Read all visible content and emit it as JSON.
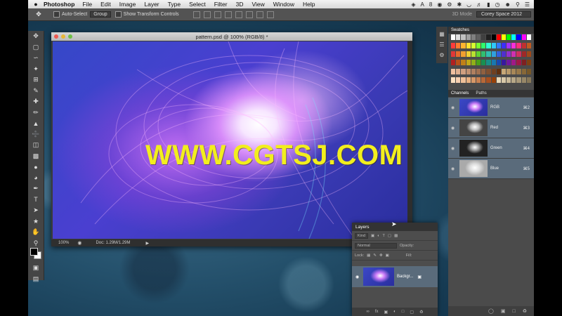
{
  "menubar": {
    "apple": "",
    "app": "Photoshop",
    "items": [
      "File",
      "Edit",
      "Image",
      "Layer",
      "Type",
      "Select",
      "Filter",
      "3D",
      "View",
      "Window",
      "Help"
    ],
    "status": "8"
  },
  "options": {
    "auto_select": "Auto-Select",
    "group_select": "Group",
    "show_transform": "Show Transform Controls",
    "mode_3d": "3D Mode",
    "workspace": "Corey Space 2012"
  },
  "document": {
    "title": "pattern.psd @ 100% (RGB/8) *",
    "zoom": "100%",
    "doc_size": "Doc: 1.29M/1.29M"
  },
  "watermark": "WWW.CGTSJ.COM",
  "swatches_panel": {
    "title": "Swatches",
    "colors": [
      "#ffffff",
      "#e0e0e0",
      "#c0c0c0",
      "#a0a0a0",
      "#808080",
      "#606060",
      "#404040",
      "#202020",
      "#000000",
      "#ff0000",
      "#ffff00",
      "#00ff00",
      "#00ffff",
      "#0000ff",
      "#ff00ff",
      "#ffffff",
      "#ff3b3b",
      "#ff7a2f",
      "#ffb52f",
      "#ffe02f",
      "#d7ff2f",
      "#7aff2f",
      "#2fff6a",
      "#2fffd2",
      "#2fc8ff",
      "#2f7aff",
      "#3b2fff",
      "#a02fff",
      "#ff2fd8",
      "#ff2f7a",
      "#c23030",
      "#c25a20",
      "#e03838",
      "#e86a2a",
      "#f0a030",
      "#f0d030",
      "#b8e030",
      "#60d030",
      "#30c070",
      "#30c0b0",
      "#30a0e0",
      "#3060e0",
      "#5030d0",
      "#9030d0",
      "#d030b0",
      "#d03060",
      "#a02828",
      "#a04818",
      "#b02020",
      "#b85018",
      "#c08018",
      "#c0a818",
      "#90b018",
      "#48a018",
      "#189050",
      "#189088",
      "#1878b0",
      "#1848b0",
      "#3818a0",
      "#7018a0",
      "#a01888",
      "#a01848",
      "#802020",
      "#804010",
      "#f0c0a0",
      "#e0b090",
      "#d0a080",
      "#c09070",
      "#b08060",
      "#a07050",
      "#906040",
      "#805030",
      "#704020",
      "#603010",
      "#c8a878",
      "#b89868",
      "#a88858",
      "#987848",
      "#886838",
      "#785828",
      "#ffe0c0",
      "#f8d0b0",
      "#f0c098",
      "#e8b080",
      "#d89868",
      "#c88050",
      "#b86838",
      "#a85020",
      "#984008",
      "#e8d8b8",
      "#d8c8a8",
      "#c8b898",
      "#b8a888",
      "#a89878",
      "#988868",
      "#887858"
    ]
  },
  "channels_panel": {
    "tabs": [
      "Channels",
      "Paths"
    ],
    "rows": [
      {
        "label": "RGB",
        "key": "⌘2"
      },
      {
        "label": "Red",
        "key": "⌘3"
      },
      {
        "label": "Green",
        "key": "⌘4"
      },
      {
        "label": "Blue",
        "key": "⌘5"
      }
    ]
  },
  "layers_panel": {
    "title": "Layers",
    "kind": "Kind",
    "blend": "Normal",
    "opacity_label": "Opacity:",
    "lock_label": "Lock:",
    "fill_label": "Fill:",
    "layer_name": "Backgr..."
  }
}
